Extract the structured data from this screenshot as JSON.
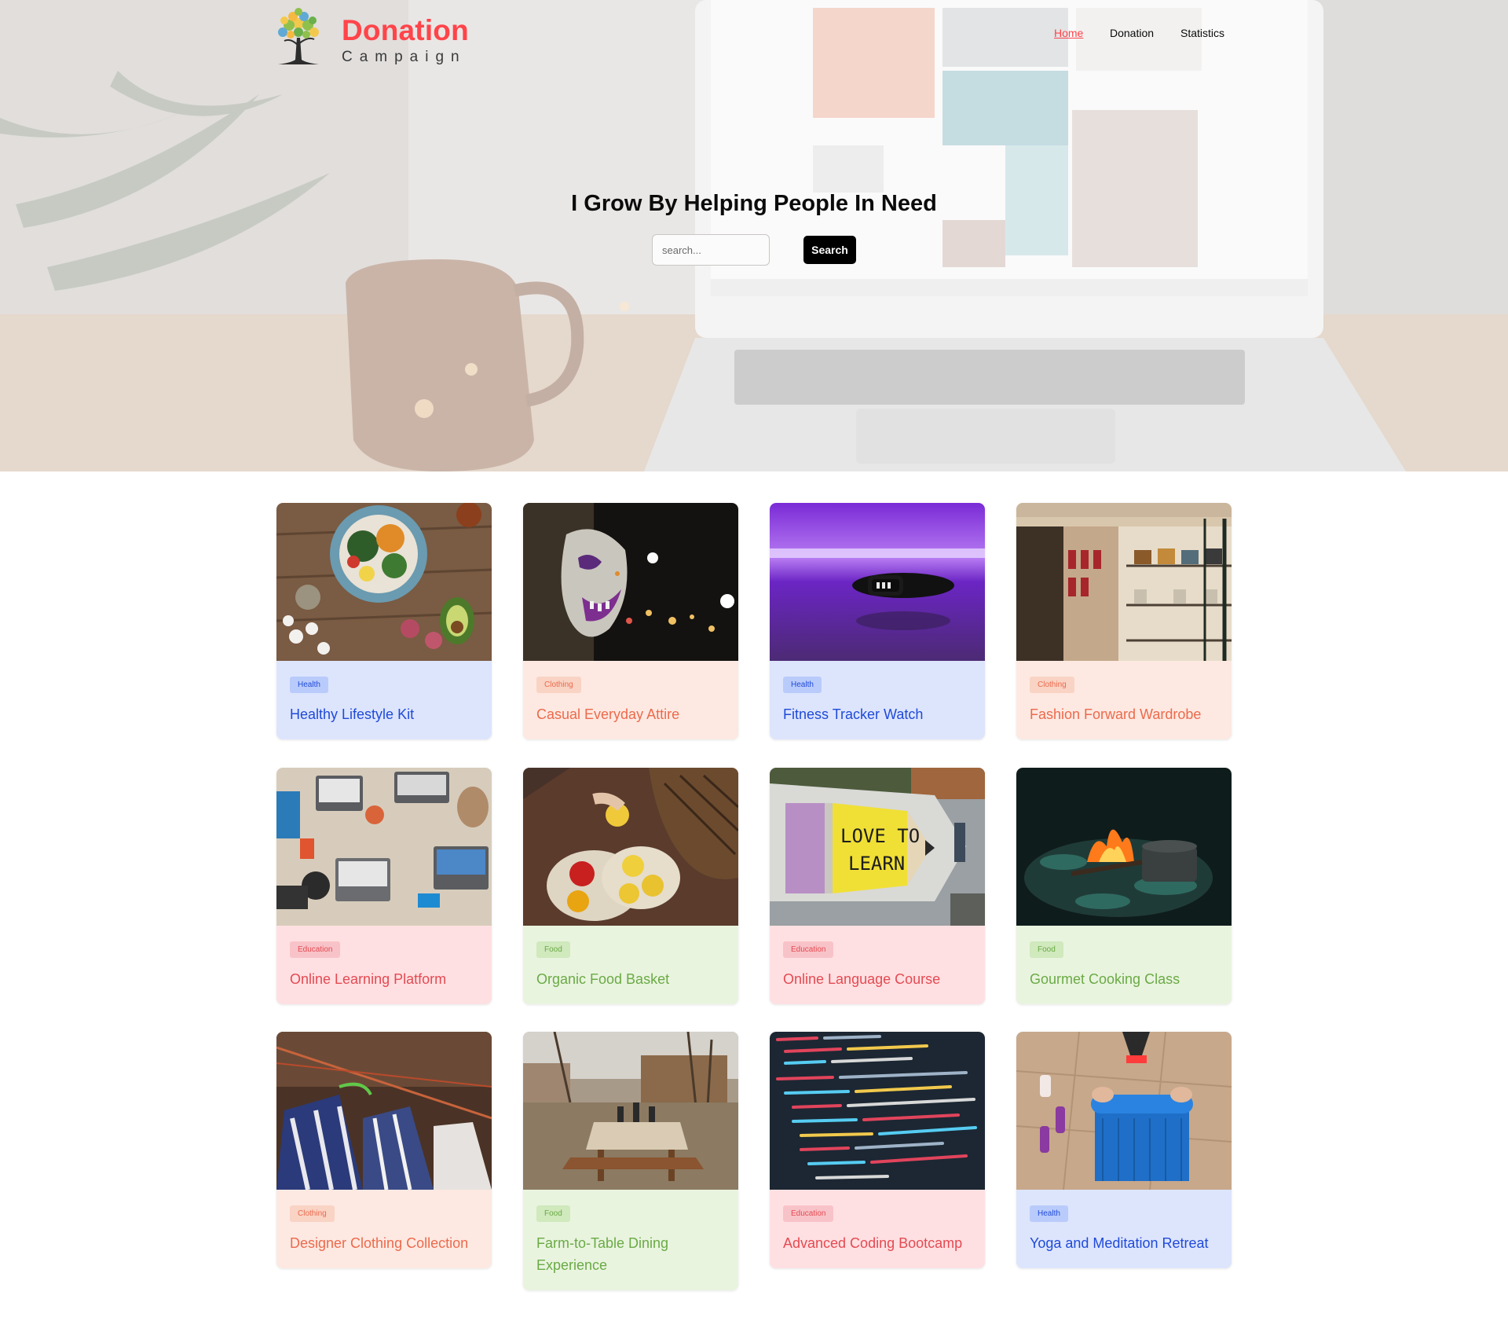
{
  "brand": {
    "title": "Donation",
    "subtitle": "Campaign"
  },
  "nav": {
    "items": [
      "Home",
      "Donation",
      "Statistics"
    ],
    "active": "Home"
  },
  "hero": {
    "title": "I Grow By Helping People In Need",
    "search_placeholder": "search...",
    "search_button": "Search"
  },
  "colors": {
    "accent": "#ff444a",
    "health": "#1f4ad9",
    "clothing": "#ec6a4c",
    "education": "#e44a52",
    "food": "#6aaa45"
  },
  "cards": [
    {
      "category": "Health",
      "title": "Healthy Lifestyle Kit",
      "image": "salad-bowl"
    },
    {
      "category": "Clothing",
      "title": "Casual Everyday Attire",
      "image": "clown-mask"
    },
    {
      "category": "Health",
      "title": "Fitness Tracker Watch",
      "image": "fitness-band"
    },
    {
      "category": "Clothing",
      "title": "Fashion Forward Wardrobe",
      "image": "boutique-shelves"
    },
    {
      "category": "Education",
      "title": "Online Learning Platform",
      "image": "laptops-on-table"
    },
    {
      "category": "Food",
      "title": "Organic Food Basket",
      "image": "produce-bags"
    },
    {
      "category": "Education",
      "title": "Online Language Course",
      "image": "love-to-learn-sign"
    },
    {
      "category": "Food",
      "title": "Gourmet Cooking Class",
      "image": "campfire-pot"
    },
    {
      "category": "Clothing",
      "title": "Designer Clothing Collection",
      "image": "clothes-on-line"
    },
    {
      "category": "Food",
      "title": "Farm-to-Table Dining Experience",
      "image": "outdoor-table"
    },
    {
      "category": "Education",
      "title": "Advanced Coding Bootcamp",
      "image": "code-screen"
    },
    {
      "category": "Health",
      "title": "Yoga and Meditation Retreat",
      "image": "yoga-mat"
    }
  ]
}
